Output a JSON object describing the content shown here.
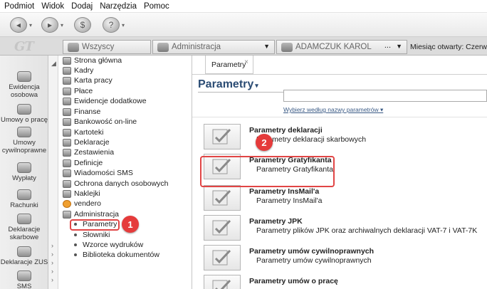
{
  "menubar": [
    "Podmiot",
    "Widok",
    "Dodaj",
    "Narzędzia",
    "Pomoc"
  ],
  "tabbar": {
    "logo": "GT",
    "users_tab": "Wszyscy",
    "module_tab": "Administracja",
    "person_tab": "ADAMCZUK KAROL",
    "more_indicator": "...",
    "month_label": "Miesiąc otwarty: Czerwiec"
  },
  "left_nav": [
    {
      "label": "Ewidencja osobowa"
    },
    {
      "label": "Umowy o pracę"
    },
    {
      "label": "Umowy cywilnoprawne"
    },
    {
      "label": "Wypłaty"
    },
    {
      "label": "Rachunki"
    },
    {
      "label": "Deklaracje skarbowe"
    },
    {
      "label": "Deklaracje ZUS"
    },
    {
      "label": "SMS"
    }
  ],
  "tree": {
    "items": [
      "Strona główna",
      "Kadry",
      "Karta pracy",
      "Płace",
      "Ewidencje dodatkowe",
      "Finanse",
      "Bankowość on-line",
      "Kartoteki",
      "Deklaracje",
      "Zestawienia",
      "Definicje",
      "Wiadomości SMS",
      "Ochrona danych osobowych",
      "Naklejki",
      "vendero",
      "Administracja"
    ],
    "sub_items": [
      "Parametry",
      "Słowniki",
      "Wzorce wydruków",
      "Biblioteka dokumentów"
    ]
  },
  "main": {
    "tab_label": "Parametry",
    "tab_close": "×",
    "title": "Parametry",
    "sort_link": "Wybierz według nazwy parametrów ▾",
    "params": [
      {
        "title": "Parametry deklaracji",
        "desc": "Parametry deklaracji skarbowych"
      },
      {
        "title": "Parametry Gratyfikanta",
        "desc": "Parametry Gratyfikanta"
      },
      {
        "title": "Parametry InsMail'a",
        "desc": "Parametry InsMail'a"
      },
      {
        "title": "Parametry JPK",
        "desc": "Parametry plików JPK oraz archiwalnych deklaracji VAT-7 i VAT-7K"
      },
      {
        "title": "Parametry umów cywilnoprawnych",
        "desc": "Parametry umów cywilnoprawnych"
      },
      {
        "title": "Parametry umów o pracę",
        "desc": ""
      }
    ]
  },
  "annotations": {
    "step1": "1",
    "step2": "2"
  },
  "colors": {
    "accent_red": "#e14545",
    "title_blue": "#2b4c74"
  }
}
